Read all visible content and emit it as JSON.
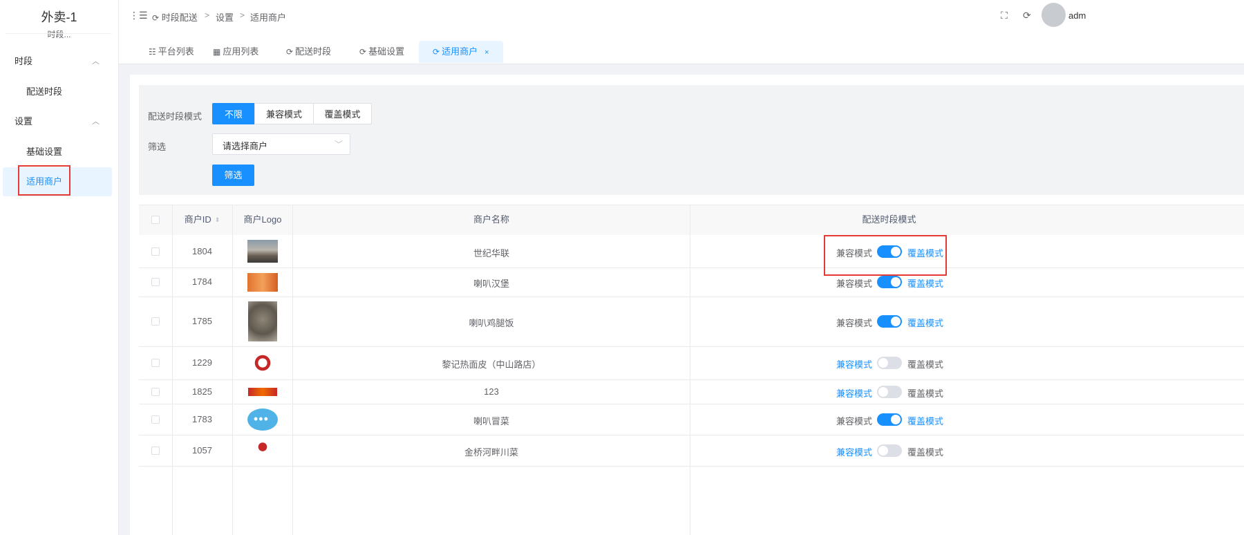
{
  "sidebar": {
    "title": "外卖-1",
    "subtitle": "时段...",
    "groups": [
      {
        "label": "时段",
        "items": [
          "配送时段"
        ]
      },
      {
        "label": "设置",
        "items": [
          "基础设置",
          "适用商户"
        ]
      }
    ],
    "active_item": "适用商户"
  },
  "header": {
    "breadcrumb": [
      "时段配送",
      "设置",
      "适用商户"
    ],
    "user": "adm"
  },
  "tabs": [
    {
      "label": "平台列表",
      "icon": "list-icon"
    },
    {
      "label": "应用列表",
      "icon": "grid-icon"
    },
    {
      "label": "配送时段",
      "icon": "refresh-icon"
    },
    {
      "label": "基础设置",
      "icon": "refresh-icon"
    },
    {
      "label": "适用商户",
      "icon": "refresh-icon",
      "active": true,
      "closable": true
    }
  ],
  "filters": {
    "mode_label": "配送时段模式",
    "mode_options": [
      "不限",
      "兼容模式",
      "覆盖模式"
    ],
    "mode_selected": "不限",
    "filter_label": "筛选",
    "merchant_select": "请选择商户",
    "submit_label": "筛选"
  },
  "table": {
    "columns": [
      "商户ID",
      "商户Logo",
      "商户名称",
      "配送时段模式"
    ],
    "mode_left": "兼容模式",
    "mode_right": "覆盖模式",
    "rows": [
      {
        "id": "1804",
        "name": "世纪华联",
        "mode": "覆盖模式"
      },
      {
        "id": "1784",
        "name": "喇叭汉堡",
        "mode": "覆盖模式"
      },
      {
        "id": "1785",
        "name": "喇叭鸡腿饭",
        "mode": "覆盖模式"
      },
      {
        "id": "1229",
        "name": "黎记热面皮（中山路店）",
        "mode": "兼容模式"
      },
      {
        "id": "1825",
        "name": "123",
        "mode": "兼容模式"
      },
      {
        "id": "1783",
        "name": "喇叭冒菜",
        "mode": "覆盖模式"
      },
      {
        "id": "1057",
        "name": "金桥河畔川菜",
        "mode": "兼容模式"
      }
    ]
  },
  "colors": {
    "primary": "#1890ff",
    "highlight": "#e53935"
  }
}
